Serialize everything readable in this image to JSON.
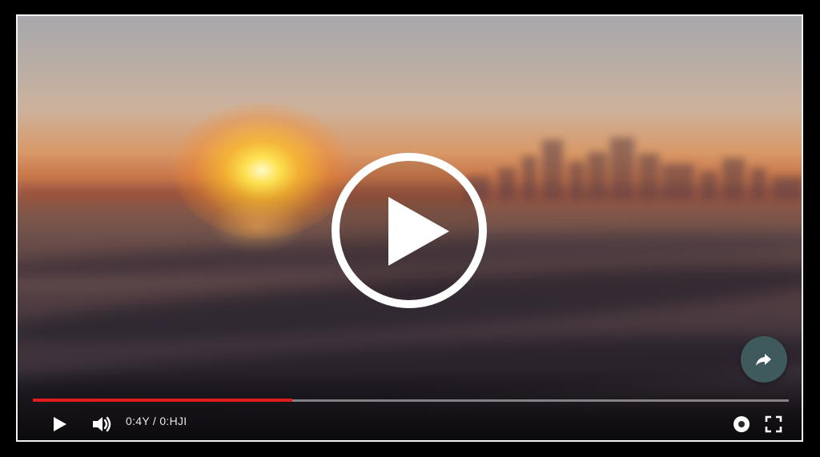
{
  "player": {
    "time_display": "0:4Y / 0:HJI",
    "progress_fraction": 0.343,
    "accent_color": "#e21b1b",
    "track_color": "#c8c8c8",
    "fab_color": "#3e5a5c"
  },
  "icons": {
    "big_play": "play-circle-icon",
    "fab": "share-icon",
    "play": "play-icon",
    "volume": "volume-icon",
    "settings": "settings-icon",
    "fullscreen": "fullscreen-icon"
  }
}
